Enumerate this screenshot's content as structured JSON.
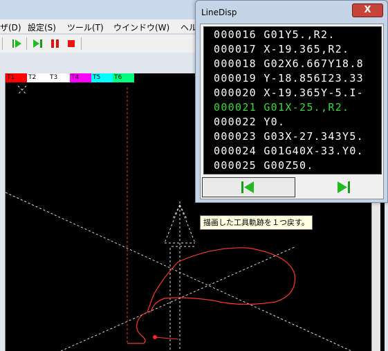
{
  "menu": {
    "view_partial": "ザ(D)",
    "settings": "設定(S)",
    "tools": "ツール(T)",
    "window": "ウインドウ(W)",
    "help_partial": "ヘル"
  },
  "toolbar": {
    "buttons": [
      "play-icon",
      "step-icon",
      "pause-icon",
      "stop-icon"
    ]
  },
  "tool_tabs": [
    {
      "label": "T1",
      "color": "#ff0000"
    },
    {
      "label": "T2",
      "color": "#ffffff"
    },
    {
      "label": "T3",
      "color": "#ffffff"
    },
    {
      "label": "T4",
      "color": "#ff00ff"
    },
    {
      "label": "T5",
      "color": "#00ffff"
    },
    {
      "label": "T6",
      "color": "#00ff80"
    }
  ],
  "linedisp": {
    "title": "LineDisp",
    "close_symbol": "X",
    "lines": [
      {
        "num": "000016",
        "code": "G01Y5.,R2."
      },
      {
        "num": "000017",
        "code": "X-19.365,R2."
      },
      {
        "num": "000018",
        "code": "G02X6.667Y18.8"
      },
      {
        "num": "000019",
        "code": "Y-18.856I23.33"
      },
      {
        "num": "000020",
        "code": "X-19.365Y-5.I-"
      },
      {
        "num": "000021",
        "code": "G01X-25.,R2."
      },
      {
        "num": "000022",
        "code": "Y0."
      },
      {
        "num": "000023",
        "code": "G03X-27.343Y5."
      },
      {
        "num": "000024",
        "code": "G01G40X-33.Y0."
      },
      {
        "num": "000025",
        "code": "G00Z50."
      }
    ],
    "highlight_index": 5,
    "colors": {
      "normal": "#ffffff",
      "highlight": "#33dd33"
    }
  },
  "tooltip": "描画した工具軌跡を１つ戻す。"
}
